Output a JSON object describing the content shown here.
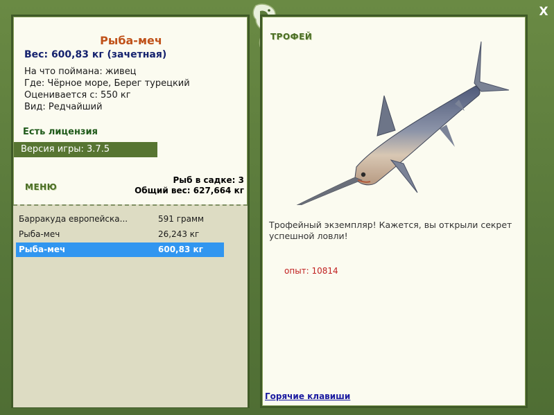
{
  "header": {
    "close_label": "X"
  },
  "fish": {
    "name": "Рыба-меч",
    "weight_line": "Вес: 600,83 кг (зачетная)",
    "caught_with": "На что поймана: живец",
    "location": "Где: Чёрное море, Берег турецкий",
    "rated_from": "Оценивается с: 550 кг",
    "rarity": "Вид: Редчайший"
  },
  "license": "Есть лицензия",
  "version": "Версия игры: 3.7.5",
  "menu_label": "МЕНЮ",
  "keepnet": {
    "fish_count": "Рыб в садке: 3",
    "total_weight": "Общий вес: 627,664 кг"
  },
  "catches": [
    {
      "name": "Барракуда европейска...",
      "weight": "591 грамм",
      "selected": false
    },
    {
      "name": "Рыба-меч",
      "weight": "26,243 кг",
      "selected": false
    },
    {
      "name": "Рыба-меч",
      "weight": "600,83 кг",
      "selected": true
    }
  ],
  "trophy": {
    "title": "ТРОФЕЙ",
    "description": "Трофейный экземпляр! Кажется, вы открыли секрет успешной ловли!",
    "experience": "опыт: 10814"
  },
  "hotkeys_label": "Горячие клавиши",
  "colors": {
    "frame_green": "#5b7a3a",
    "panel_bg": "#fbfbf0",
    "list_bg": "#dddcc3",
    "selected_row": "#3196f0",
    "fish_name": "#c0521a",
    "weight_text": "#15226e",
    "experience_text": "#c02020"
  },
  "icons": {
    "logo": "fish-emblem-icon",
    "close": "close-icon",
    "trophy_fish": "swordfish-illustration"
  }
}
